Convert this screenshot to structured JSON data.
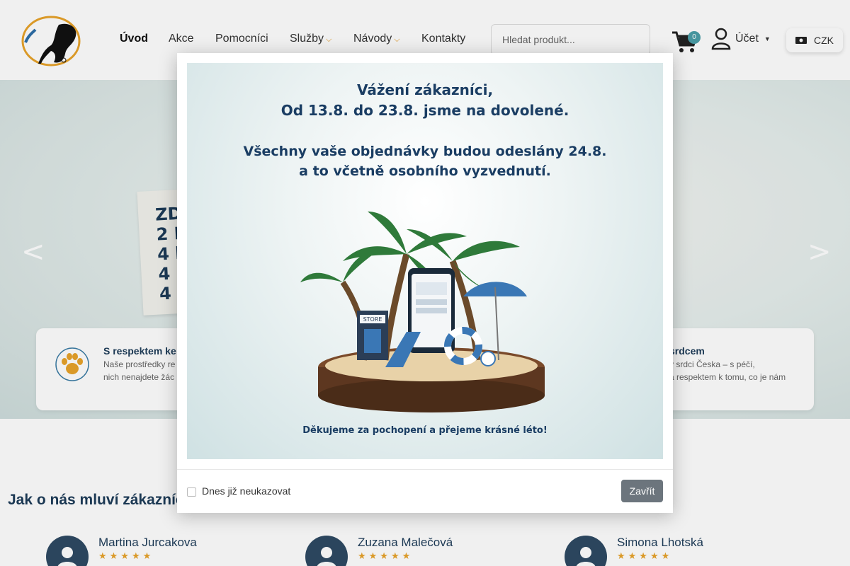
{
  "header": {
    "nav": [
      {
        "label": "Úvod",
        "active": true
      },
      {
        "label": "Akce"
      },
      {
        "label": "Pomocníci"
      },
      {
        "label": "Služby",
        "dropdown": true
      },
      {
        "label": "Návody",
        "dropdown": true
      },
      {
        "label": "Kontakty"
      }
    ],
    "search_placeholder": "Hledat produkt...",
    "cart_count": "0",
    "account_label": "Účet",
    "currency": "CZK"
  },
  "hero": {
    "prev": "<",
    "next": ">",
    "card_text": "ZD\n2 L\n4 l\n4 r\n4 s",
    "features": {
      "left": {
        "title": "S respektem ke",
        "text": "Naše prostředky re\nnich nenajdete žác"
      },
      "right": {
        "title": "srdcem",
        "text": "v srdci Česka – s péčí,\na respektem k tomu, co je nám"
      }
    }
  },
  "modal": {
    "line1": "Vážení zákazníci,",
    "line2": "Od 13.8. do 23.8. jsme na dovolené.",
    "line3": "Všechny vaše objednávky budou odeslány 24.8.",
    "line4": "a to včetně osobního vyzvednutí.",
    "line5": "Děkujeme za pochopení a přejeme krásné léto!",
    "store_label": "STORE",
    "dont_show": "Dnes již neukazovat",
    "close": "Zavřít"
  },
  "reviews": {
    "title": "Jak o nás mluví zákazníc",
    "items": [
      {
        "name": "Martina Jurcakova",
        "stars": "★★★★★"
      },
      {
        "name": "Zuzana Malečová",
        "stars": "★★★★★"
      },
      {
        "name": "Simona Lhotská",
        "stars": "★★★★★"
      }
    ]
  },
  "colors": {
    "brand_dark": "#1d3c59",
    "accent_orange": "#e08a00",
    "badge_teal": "#4b9fa8",
    "star": "#e8a32a",
    "close_button": "#6c757d"
  }
}
